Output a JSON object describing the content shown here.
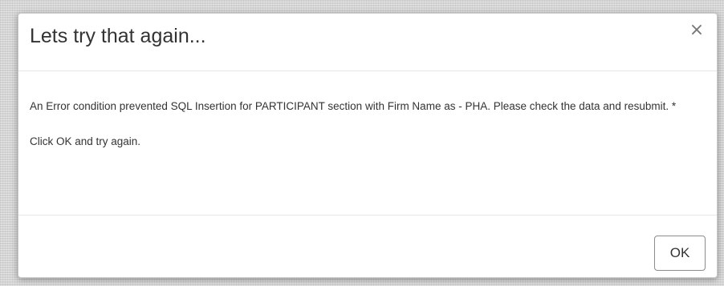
{
  "dialog": {
    "title": "Lets try that again...",
    "close_icon_glyph": "×",
    "close_icon_name": "close-icon",
    "message": "An Error condition prevented SQL Insertion for PARTICIPANT section with Firm Name as - PHA. Please check the data and resubmit. *",
    "instruction": "Click OK and try again.",
    "ok_label": "OK"
  }
}
